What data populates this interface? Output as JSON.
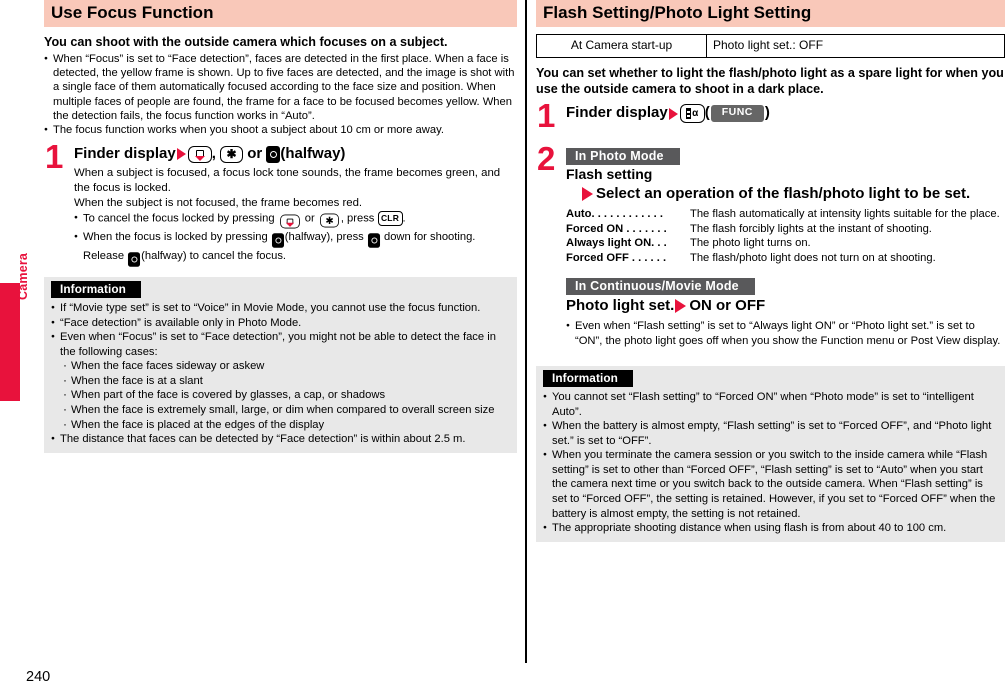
{
  "page": {
    "number": "240",
    "side_tab_label": "Camera"
  },
  "left": {
    "section_title": "Use Focus Function",
    "lead": "You can shoot with the outside camera which focuses on a subject.",
    "intro_bullets": [
      "When “Focus” is set to “Face detection”, faces are detected in the first place. When a face is detected, the yellow frame is shown. Up to five faces are detected, and the image is shot with a single face of them automatically focused according to the face size and position. When multiple faces of people are found, the frame for a face to be focused becomes yellow. When the detection fails, the focus function works in “Auto”.",
      "The focus function works when you shoot a subject about 10 cm or more away."
    ],
    "step1": {
      "number": "1",
      "title_pre": "Finder display",
      "comma": ",",
      "or": "or",
      "halfway": "(halfway)",
      "icon_select": "select-key-icon",
      "icon_star": "star-key-icon",
      "icon_camera": "camera-key-icon",
      "body_line1": "When a subject is focused, a focus lock tone sounds, the frame becomes green, and the focus is locked.",
      "body_line2": "When the subject is not focused, the frame becomes red.",
      "bullet1_a": "To cancel the focus locked by pressing",
      "bullet1_b": "or",
      "bullet1_c": ", press",
      "bullet1_d": ".",
      "bullet2_a": "When the focus is locked by pressing",
      "bullet2_b": "(halfway), press",
      "bullet2_c": "down for shooting. Release",
      "bullet2_d": "(halfway) to cancel the focus."
    },
    "information": {
      "title": "Information",
      "items": [
        "If “Movie type set” is set to “Voice” in Movie Mode, you cannot use the focus function.",
        "“Face detection” is available only in Photo Mode.",
        "Even when “Focus” is set to “Face detection”, you might not be able to detect the face in the following cases:"
      ],
      "sub_items": [
        "When the face faces sideway or askew",
        "When the face is at a slant",
        "When part of the face is covered by glasses, a cap, or shadows",
        "When the face is extremely small, large, or dim when compared to overall screen size",
        "When the face is placed at the edges of the display"
      ],
      "last_item": "The distance that faces can be detected by “Face detection” is within about 2.5 m."
    }
  },
  "right": {
    "section_title": "Flash Setting/Photo Light Setting",
    "table": {
      "rows": [
        {
          "key": "At Camera start-up",
          "value": "Photo light set.: OFF"
        }
      ]
    },
    "lead": "You can set whether to light the flash/photo light as a spare light for when you use the outside camera to shoot in a dark place.",
    "step1": {
      "number": "1",
      "title_pre": "Finder display",
      "icon_func": "func-key-icon",
      "func_badge": "FUNC",
      "paren_open": "(",
      "paren_close": ")"
    },
    "step2": {
      "number": "2",
      "mode_chip_1": "In Photo Mode",
      "sub_head_1": "Flash setting",
      "sub_head_2": "Select an operation of the flash/photo light to be set.",
      "options": [
        {
          "term": "Auto",
          "leader": ". . . . . . . . . . . .",
          "desc": "The flash automatically at intensity lights suitable for the place."
        },
        {
          "term": "Forced ON",
          "leader": ". . . . . . .",
          "desc": "The flash forcibly lights at the instant of shooting."
        },
        {
          "term": "Always light ON",
          "leader": ". . .",
          "desc": "The photo light turns on."
        },
        {
          "term": "Forced OFF",
          "leader": ". . . . . .",
          "desc": "The flash/photo light does not turn on at shooting."
        }
      ],
      "mode_chip_2": "In Continuous/Movie Mode",
      "sub_head_3_pre": "Photo light set.",
      "sub_head_3_post": "ON or OFF",
      "note": "Even when “Flash setting” is set to “Always light ON” or “Photo light set.” is set to “ON”, the photo light goes off when you show the Function menu or Post View display."
    },
    "information": {
      "title": "Information",
      "items": [
        "You cannot set “Flash setting” to “Forced ON” when “Photo mode” is set to “intelligent Auto”.",
        "When the battery is almost empty, “Flash setting” is set to “Forced OFF”, and “Photo light set.” is set to “OFF”.",
        "When you terminate the camera session or you switch to the inside camera while “Flash setting” is set to other than “Forced OFF”, “Flash setting” is set to “Auto” when you start the camera next time or you switch back to the outside camera. When “Flash setting” is set to “Forced OFF”, the setting is retained. However, if you set to “Forced OFF” when the battery is almost empty, the setting is not retained.",
        "The appropriate shooting distance when using flash is from about 40 to 100 cm."
      ]
    }
  },
  "colors": {
    "accent_red": "#e8123c",
    "header_pink": "#f9c8b9",
    "info_bg": "#e8e8e8",
    "chip_gray": "#59595b",
    "func_gray": "#666666"
  }
}
